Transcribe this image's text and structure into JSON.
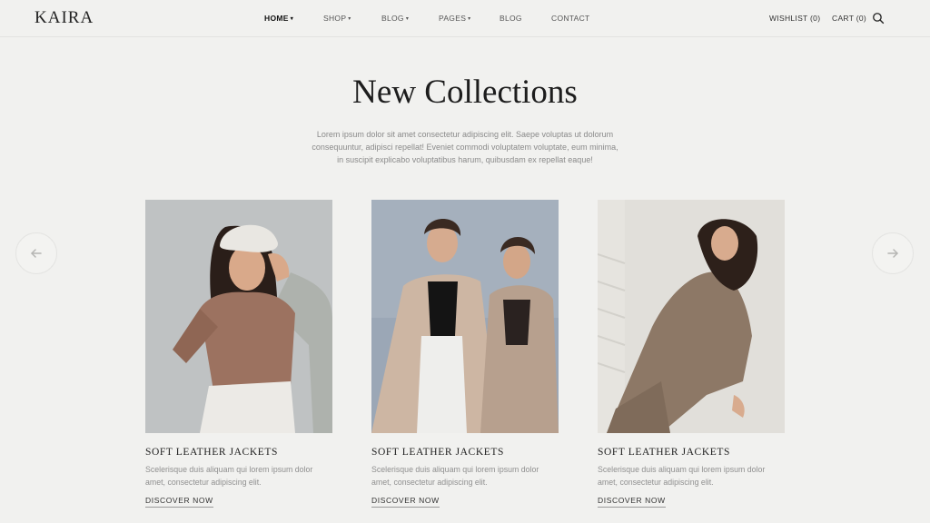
{
  "brand": {
    "logo": "KAIRA"
  },
  "nav": {
    "items": [
      {
        "label": "HOME",
        "caret": "▾"
      },
      {
        "label": "SHOP",
        "caret": "▾"
      },
      {
        "label": "BLOG",
        "caret": "▾"
      },
      {
        "label": "PAGES",
        "caret": "▾"
      },
      {
        "label": "BLOG",
        "caret": ""
      },
      {
        "label": "CONTACT",
        "caret": ""
      }
    ],
    "wishlist": "WISHLIST (0)",
    "cart": "CART (0)"
  },
  "hero": {
    "title": "New Collections",
    "intro": "Lorem ipsum dolor sit amet consectetur adipiscing elit. Saepe voluptas ut dolorum consequuntur, adipisci repellat! Eveniet commodi voluptatem voluptate, eum minima, in suscipit explicabo voluptatibus harum, quibusdam ex repellat eaque!"
  },
  "cards": [
    {
      "title": "SOFT LEATHER JACKETS",
      "desc": "Scelerisque duis aliquam qui lorem ipsum dolor amet, consectetur adipiscing elit.",
      "link": "DISCOVER NOW"
    },
    {
      "title": "SOFT LEATHER JACKETS",
      "desc": "Scelerisque duis aliquam qui lorem ipsum dolor amet, consectetur adipiscing elit.",
      "link": "DISCOVER NOW"
    },
    {
      "title": "SOFT LEATHER JACKETS",
      "desc": "Scelerisque duis aliquam qui lorem ipsum dolor amet, consectetur adipiscing elit.",
      "link": "DISCOVER NOW"
    }
  ],
  "icons": {
    "search": "search-icon",
    "prev": "arrow-left-icon",
    "next": "arrow-right-icon"
  },
  "colors": {
    "background": "#f1f1ef",
    "text": "#222222",
    "muted": "#8a8a8a"
  }
}
